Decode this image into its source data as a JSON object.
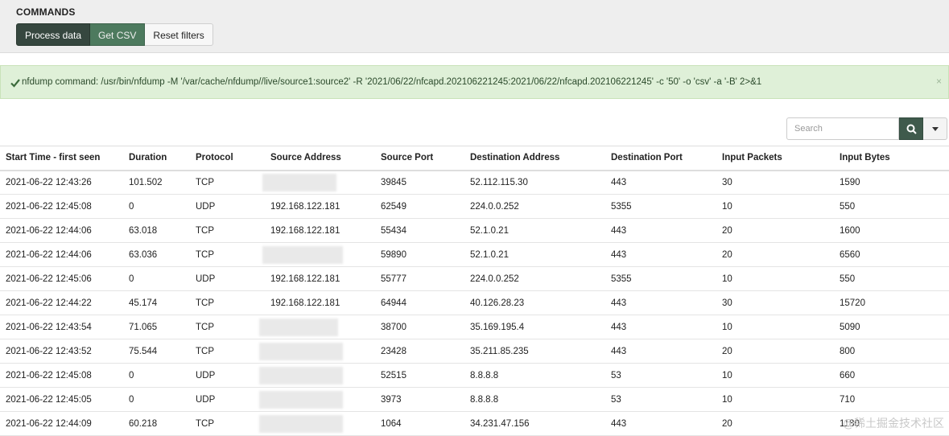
{
  "commands": {
    "title": "COMMANDS",
    "process_label": "Process data",
    "csv_label": "Get CSV",
    "reset_label": "Reset filters"
  },
  "alert": {
    "text": "nfdump command: /usr/bin/nfdump -M '/var/cache/nfdump//live/source1:source2' -R '2021/06/22/nfcapd.202106221245:2021/06/22/nfcapd.202106221245' -c '50' -o 'csv' -a '-B' 2>&1",
    "close": "×",
    "icon": "check-icon"
  },
  "search": {
    "placeholder": "Search",
    "button_icon": "search-icon",
    "caret_icon": "caret-down-icon"
  },
  "colors": {
    "primary": "#36473f",
    "accent": "#4d7a5e",
    "alert_bg": "#dff0d8"
  },
  "table": {
    "columns": [
      "Start Time - first seen",
      "Duration",
      "Protocol",
      "Source Address",
      "Source Port",
      "Destination Address",
      "Destination Port",
      "Input Packets",
      "Input Bytes"
    ],
    "rows": [
      {
        "start": "2021-06-22 12:43:26",
        "duration": "101.502",
        "protocol": "TCP",
        "src": "",
        "sport": "39845",
        "dst": "52.112.115.30",
        "dport": "443",
        "packets": "30",
        "bytes": "1590"
      },
      {
        "start": "2021-06-22 12:45:08",
        "duration": "0",
        "protocol": "UDP",
        "src": "192.168.122.181",
        "sport": "62549",
        "dst": "224.0.0.252",
        "dport": "5355",
        "packets": "10",
        "bytes": "550"
      },
      {
        "start": "2021-06-22 12:44:06",
        "duration": "63.018",
        "protocol": "TCP",
        "src": "192.168.122.181",
        "sport": "55434",
        "dst": "52.1.0.21",
        "dport": "443",
        "packets": "20",
        "bytes": "1600"
      },
      {
        "start": "2021-06-22 12:44:06",
        "duration": "63.036",
        "protocol": "TCP",
        "src": "",
        "sport": "59890",
        "dst": "52.1.0.21",
        "dport": "443",
        "packets": "20",
        "bytes": "6560"
      },
      {
        "start": "2021-06-22 12:45:06",
        "duration": "0",
        "protocol": "UDP",
        "src": "192.168.122.181",
        "sport": "55777",
        "dst": "224.0.0.252",
        "dport": "5355",
        "packets": "10",
        "bytes": "550"
      },
      {
        "start": "2021-06-22 12:44:22",
        "duration": "45.174",
        "protocol": "TCP",
        "src": "192.168.122.181",
        "sport": "64944",
        "dst": "40.126.28.23",
        "dport": "443",
        "packets": "30",
        "bytes": "15720"
      },
      {
        "start": "2021-06-22 12:43:54",
        "duration": "71.065",
        "protocol": "TCP",
        "src": "",
        "sport": "38700",
        "dst": "35.169.195.4",
        "dport": "443",
        "packets": "10",
        "bytes": "5090"
      },
      {
        "start": "2021-06-22 12:43:52",
        "duration": "75.544",
        "protocol": "TCP",
        "src": "",
        "sport": "23428",
        "dst": "35.211.85.235",
        "dport": "443",
        "packets": "20",
        "bytes": "800"
      },
      {
        "start": "2021-06-22 12:45:08",
        "duration": "0",
        "protocol": "UDP",
        "src": "",
        "sport": "52515",
        "dst": "8.8.8.8",
        "dport": "53",
        "packets": "10",
        "bytes": "660"
      },
      {
        "start": "2021-06-22 12:45:05",
        "duration": "0",
        "protocol": "UDP",
        "src": "",
        "sport": "3973",
        "dst": "8.8.8.8",
        "dport": "53",
        "packets": "10",
        "bytes": "710"
      },
      {
        "start": "2021-06-22 12:44:09",
        "duration": "60.218",
        "protocol": "TCP",
        "src": "",
        "sport": "1064",
        "dst": "34.231.47.156",
        "dport": "443",
        "packets": "20",
        "bytes": "1180"
      }
    ]
  },
  "watermark": "@稀土掘金技术社区"
}
